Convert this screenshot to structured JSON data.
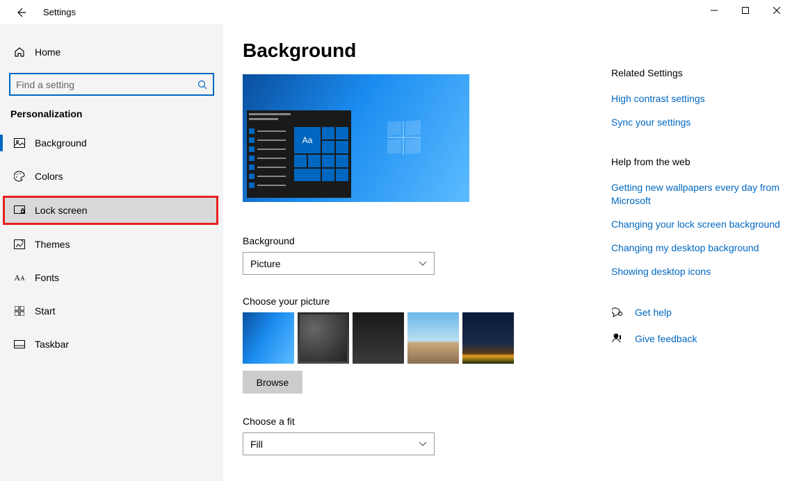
{
  "titlebar": {
    "title": "Settings"
  },
  "sidebar": {
    "home": "Home",
    "search_placeholder": "Find a setting",
    "category": "Personalization",
    "items": [
      {
        "label": "Background"
      },
      {
        "label": "Colors"
      },
      {
        "label": "Lock screen"
      },
      {
        "label": "Themes"
      },
      {
        "label": "Fonts"
      },
      {
        "label": "Start"
      },
      {
        "label": "Taskbar"
      }
    ]
  },
  "main": {
    "heading": "Background",
    "preview_tile_text": "Aa",
    "background_label": "Background",
    "background_value": "Picture",
    "choose_picture_label": "Choose your picture",
    "browse_label": "Browse",
    "choose_fit_label": "Choose a fit",
    "fit_value": "Fill"
  },
  "right": {
    "related_heading": "Related Settings",
    "related_links": [
      "High contrast settings",
      "Sync your settings"
    ],
    "help_heading": "Help from the web",
    "help_links": [
      "Getting new wallpapers every day from Microsoft",
      "Changing your lock screen background",
      "Changing my desktop background",
      "Showing desktop icons"
    ],
    "get_help": "Get help",
    "give_feedback": "Give feedback"
  }
}
